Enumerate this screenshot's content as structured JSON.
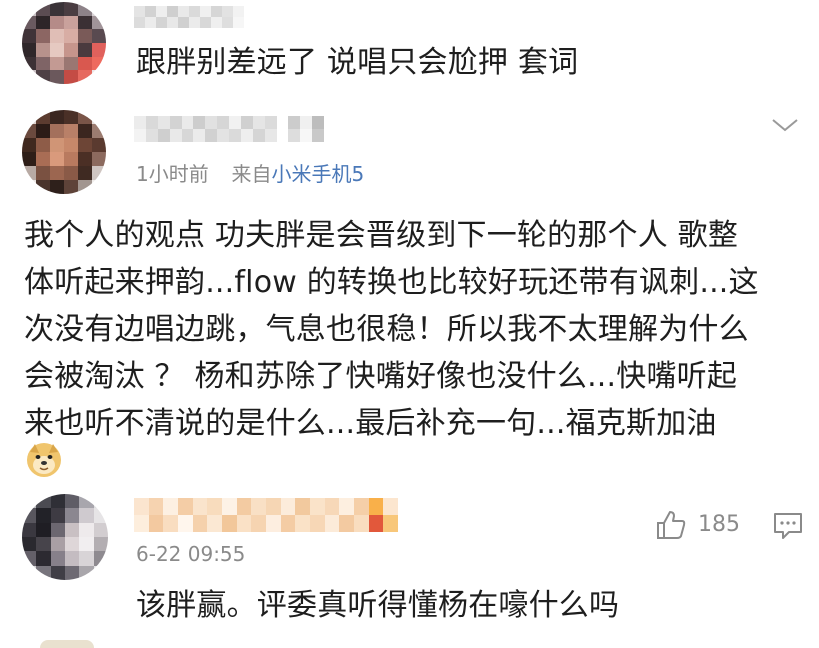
{
  "comments": [
    {
      "text": "跟胖别差远了 说唱只会尬押 套词"
    },
    {
      "time": "1小时前",
      "source_prefix": "来自",
      "source_device": "小米手机5",
      "text_lines": [
        "我个人的观点 功夫胖是会晋级到下一轮的那个人 歌整",
        "体听起来押韵...flow 的转换也比较好玩还带有讽刺...这",
        "次没有边唱边跳，气息也很稳！所以我不太理解为什么",
        "会被淘汰 ？ 杨和苏除了快嘴好像也没什么...快嘴听起",
        "来也听不清说的是什么...最后补充一句...福克斯加油"
      ],
      "emoji": "doge-emoji"
    },
    {
      "time": "6-22 09:55",
      "like_count": "185",
      "text": "该胖赢。评委真听得懂杨在嚎什么吗"
    }
  ],
  "icons": {
    "more": "chevron-down-icon",
    "like": "thumbs-up-icon",
    "reply": "comment-icon"
  },
  "colors": {
    "link": "#4a78b8",
    "meta": "#8a8a8a",
    "text": "#1e1e1e"
  }
}
